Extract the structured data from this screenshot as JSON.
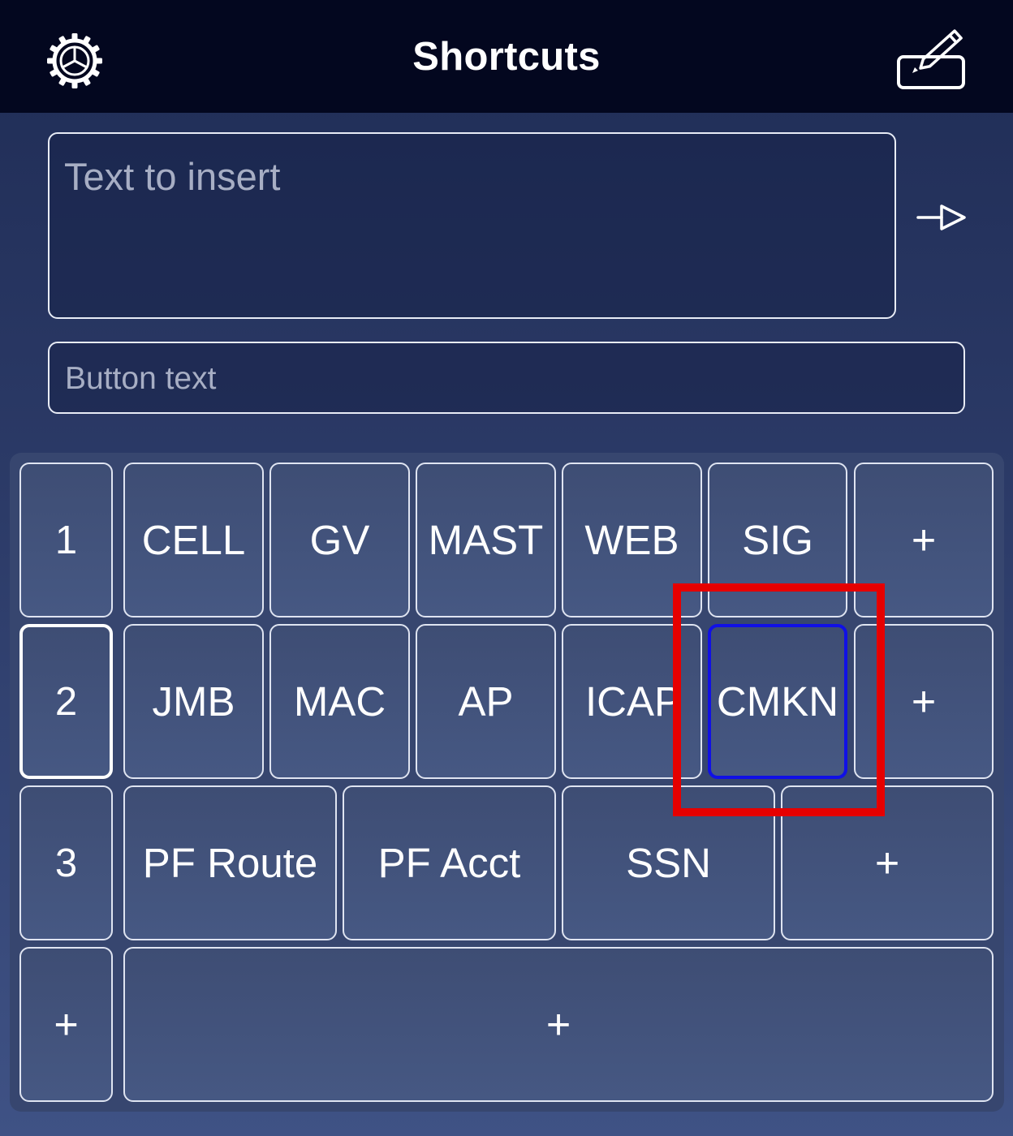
{
  "header": {
    "title": "Shortcuts"
  },
  "editor": {
    "text_placeholder": "Text to insert",
    "button_text_placeholder": "Button text"
  },
  "grid": {
    "row1": {
      "label": "1",
      "buttons": [
        "CELL",
        "GV",
        "MAST",
        "WEB",
        "SIG"
      ],
      "add": "+"
    },
    "row2": {
      "label": "2",
      "buttons": [
        "JMB",
        "MAC",
        "AP",
        "ICAP",
        "CMKN"
      ],
      "add": "+"
    },
    "row3": {
      "label": "3",
      "buttons": [
        "PF Route",
        "PF Acct",
        "SSN"
      ],
      "add": "+"
    },
    "row4": {
      "label": "+",
      "add": "+"
    }
  },
  "colors": {
    "header_bg": "#03071f",
    "focus_border": "#1010e6",
    "highlight_box": "#e60000"
  },
  "icons": {
    "settings": "gear-icon",
    "edit": "pencil-edit-icon",
    "insert": "arrow-right-icon"
  }
}
